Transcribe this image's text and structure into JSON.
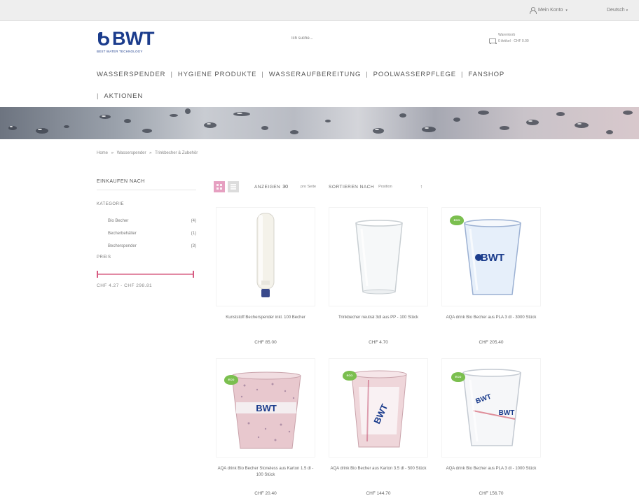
{
  "topbar": {
    "account_label": "Mein Konto",
    "language_label": "Deutsch"
  },
  "logo": {
    "brand": "BWT",
    "tagline": "BEST WATER TECHNOLOGY"
  },
  "search": {
    "placeholder": "Ich suche..."
  },
  "cart": {
    "label": "Warenkorb",
    "summary": "0 Artikel · CHF 0.00"
  },
  "nav": {
    "items": [
      "WASSERSPENDER",
      "HYGIENE PRODUKTE",
      "WASSERAUFBEREITUNG",
      "POOLWASSERPFLEGE",
      "FANSHOP",
      "AKTIONEN"
    ]
  },
  "breadcrumb": {
    "items": [
      "Home",
      "Wasserspender",
      "Trinkbecher & Zubehör"
    ],
    "separator": "»"
  },
  "sidebar": {
    "title": "EINKAUFEN NACH",
    "category_label": "KATEGORIE",
    "categories": [
      {
        "label": "Bio Becher",
        "count": "(4)"
      },
      {
        "label": "Becherbehälter",
        "count": "(1)"
      },
      {
        "label": "Becherspender",
        "count": "(3)"
      }
    ],
    "price_label": "PREIS",
    "price_min": "CHF 4.27",
    "price_max": "CHF 298.81"
  },
  "toolbar": {
    "show_label": "ANZEIGEN",
    "show_value": "30",
    "per_page": "pro Seite",
    "sort_label": "SORTIEREN NACH",
    "sort_value": "Position",
    "sort_dir": "↑"
  },
  "products": [
    {
      "name": "Kunststoff Becherspender inkl. 100 Becher",
      "price": "CHF 85.00",
      "eco": false,
      "type": "dispenser"
    },
    {
      "name": "Trinkbecher neutral 3dl aus PP - 100 Stück",
      "price": "CHF 4.70",
      "eco": false,
      "type": "clear"
    },
    {
      "name": "AQA drink Bio Becher aus PLA 3 dl - 3000 Stück",
      "price": "CHF 205.40",
      "eco": true,
      "eco_text": "ECO",
      "type": "bwt-blue"
    },
    {
      "name": "AQA drink Bio Becher Stoneless aus Karton 1.5 dl - 100 Stück",
      "price": "CHF 20.40",
      "eco": true,
      "eco_text": "ECO",
      "type": "pink-speckle"
    },
    {
      "name": "AQA drink Bio Becher aus Karton 3.5 dl - 500 Stück",
      "price": "CHF 144.70",
      "eco": true,
      "eco_text": "ECO",
      "type": "pink-paper"
    },
    {
      "name": "AQA drink Bio Becher aus PLA 3 dl - 1000 Stück",
      "price": "CHF 156.70",
      "eco": true,
      "eco_text": "ECO",
      "type": "clear-bwt"
    }
  ],
  "colors": {
    "brand": "#1b3c8c",
    "accent": "#e6a0c1",
    "slider": "#d65a81",
    "eco": "#7bbf4f"
  }
}
